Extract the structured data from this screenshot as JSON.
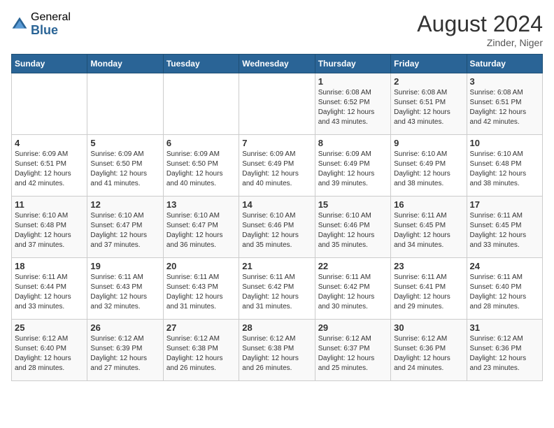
{
  "header": {
    "logo_general": "General",
    "logo_blue": "Blue",
    "title": "August 2024",
    "location": "Zinder, Niger"
  },
  "days_of_week": [
    "Sunday",
    "Monday",
    "Tuesday",
    "Wednesday",
    "Thursday",
    "Friday",
    "Saturday"
  ],
  "weeks": [
    [
      {
        "day": "",
        "content": ""
      },
      {
        "day": "",
        "content": ""
      },
      {
        "day": "",
        "content": ""
      },
      {
        "day": "",
        "content": ""
      },
      {
        "day": "1",
        "content": "Sunrise: 6:08 AM\nSunset: 6:52 PM\nDaylight: 12 hours and 43 minutes."
      },
      {
        "day": "2",
        "content": "Sunrise: 6:08 AM\nSunset: 6:51 PM\nDaylight: 12 hours and 43 minutes."
      },
      {
        "day": "3",
        "content": "Sunrise: 6:08 AM\nSunset: 6:51 PM\nDaylight: 12 hours and 42 minutes."
      }
    ],
    [
      {
        "day": "4",
        "content": "Sunrise: 6:09 AM\nSunset: 6:51 PM\nDaylight: 12 hours and 42 minutes."
      },
      {
        "day": "5",
        "content": "Sunrise: 6:09 AM\nSunset: 6:50 PM\nDaylight: 12 hours and 41 minutes."
      },
      {
        "day": "6",
        "content": "Sunrise: 6:09 AM\nSunset: 6:50 PM\nDaylight: 12 hours and 40 minutes."
      },
      {
        "day": "7",
        "content": "Sunrise: 6:09 AM\nSunset: 6:49 PM\nDaylight: 12 hours and 40 minutes."
      },
      {
        "day": "8",
        "content": "Sunrise: 6:09 AM\nSunset: 6:49 PM\nDaylight: 12 hours and 39 minutes."
      },
      {
        "day": "9",
        "content": "Sunrise: 6:10 AM\nSunset: 6:49 PM\nDaylight: 12 hours and 38 minutes."
      },
      {
        "day": "10",
        "content": "Sunrise: 6:10 AM\nSunset: 6:48 PM\nDaylight: 12 hours and 38 minutes."
      }
    ],
    [
      {
        "day": "11",
        "content": "Sunrise: 6:10 AM\nSunset: 6:48 PM\nDaylight: 12 hours and 37 minutes."
      },
      {
        "day": "12",
        "content": "Sunrise: 6:10 AM\nSunset: 6:47 PM\nDaylight: 12 hours and 37 minutes."
      },
      {
        "day": "13",
        "content": "Sunrise: 6:10 AM\nSunset: 6:47 PM\nDaylight: 12 hours and 36 minutes."
      },
      {
        "day": "14",
        "content": "Sunrise: 6:10 AM\nSunset: 6:46 PM\nDaylight: 12 hours and 35 minutes."
      },
      {
        "day": "15",
        "content": "Sunrise: 6:10 AM\nSunset: 6:46 PM\nDaylight: 12 hours and 35 minutes."
      },
      {
        "day": "16",
        "content": "Sunrise: 6:11 AM\nSunset: 6:45 PM\nDaylight: 12 hours and 34 minutes."
      },
      {
        "day": "17",
        "content": "Sunrise: 6:11 AM\nSunset: 6:45 PM\nDaylight: 12 hours and 33 minutes."
      }
    ],
    [
      {
        "day": "18",
        "content": "Sunrise: 6:11 AM\nSunset: 6:44 PM\nDaylight: 12 hours and 33 minutes."
      },
      {
        "day": "19",
        "content": "Sunrise: 6:11 AM\nSunset: 6:43 PM\nDaylight: 12 hours and 32 minutes."
      },
      {
        "day": "20",
        "content": "Sunrise: 6:11 AM\nSunset: 6:43 PM\nDaylight: 12 hours and 31 minutes."
      },
      {
        "day": "21",
        "content": "Sunrise: 6:11 AM\nSunset: 6:42 PM\nDaylight: 12 hours and 31 minutes."
      },
      {
        "day": "22",
        "content": "Sunrise: 6:11 AM\nSunset: 6:42 PM\nDaylight: 12 hours and 30 minutes."
      },
      {
        "day": "23",
        "content": "Sunrise: 6:11 AM\nSunset: 6:41 PM\nDaylight: 12 hours and 29 minutes."
      },
      {
        "day": "24",
        "content": "Sunrise: 6:11 AM\nSunset: 6:40 PM\nDaylight: 12 hours and 28 minutes."
      }
    ],
    [
      {
        "day": "25",
        "content": "Sunrise: 6:12 AM\nSunset: 6:40 PM\nDaylight: 12 hours and 28 minutes."
      },
      {
        "day": "26",
        "content": "Sunrise: 6:12 AM\nSunset: 6:39 PM\nDaylight: 12 hours and 27 minutes."
      },
      {
        "day": "27",
        "content": "Sunrise: 6:12 AM\nSunset: 6:38 PM\nDaylight: 12 hours and 26 minutes."
      },
      {
        "day": "28",
        "content": "Sunrise: 6:12 AM\nSunset: 6:38 PM\nDaylight: 12 hours and 26 minutes."
      },
      {
        "day": "29",
        "content": "Sunrise: 6:12 AM\nSunset: 6:37 PM\nDaylight: 12 hours and 25 minutes."
      },
      {
        "day": "30",
        "content": "Sunrise: 6:12 AM\nSunset: 6:36 PM\nDaylight: 12 hours and 24 minutes."
      },
      {
        "day": "31",
        "content": "Sunrise: 6:12 AM\nSunset: 6:36 PM\nDaylight: 12 hours and 23 minutes."
      }
    ]
  ]
}
